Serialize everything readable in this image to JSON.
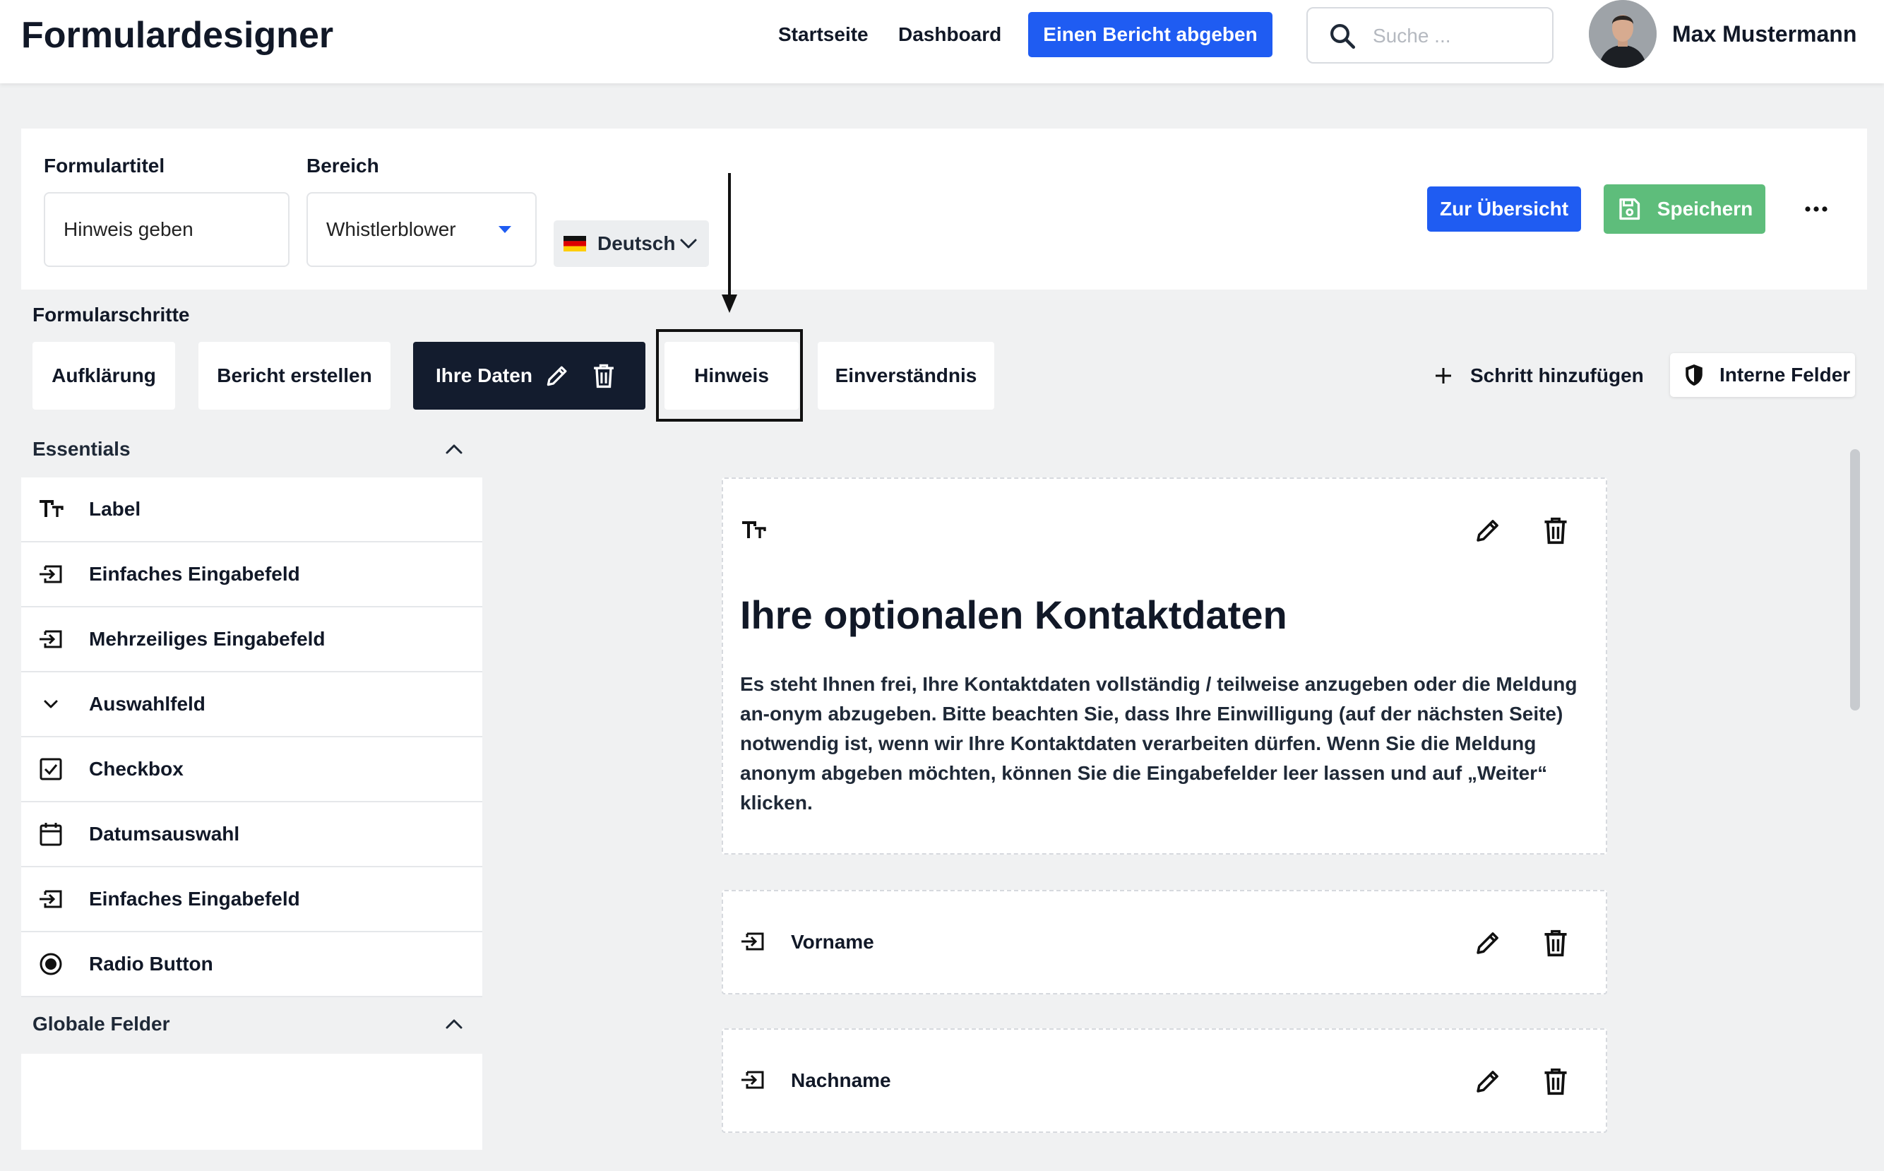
{
  "header": {
    "app_title": "Formulardesigner",
    "nav": [
      "Startseite",
      "Dashboard"
    ],
    "report_button": "Einen Bericht abgeben",
    "search_placeholder": "Suche ...",
    "user_name": "Max Mustermann"
  },
  "form": {
    "title_label": "Formulartitel",
    "title_value": "Hinweis geben",
    "area_label": "Bereich",
    "area_value": "Whistlerblower",
    "language": "Deutsch",
    "overview_button": "Zur Übersicht",
    "save_button": "Speichern"
  },
  "steps": {
    "label": "Formularschritte",
    "tabs": [
      "Aufklärung",
      "Bericht erstellen",
      "Ihre Daten",
      "Hinweis",
      "Einverständnis"
    ],
    "add_step": "Schritt hinzufügen",
    "internal_fields": "Interne Felder"
  },
  "sidebar": {
    "essentials_title": "Essentials",
    "items": [
      {
        "label": "Label",
        "icon": "text-type-icon"
      },
      {
        "label": "Einfaches Eingabefeld",
        "icon": "input-field-icon"
      },
      {
        "label": "Mehrzeiliges Eingabefeld",
        "icon": "input-field-icon"
      },
      {
        "label": "Auswahlfeld",
        "icon": "chevron-down-icon"
      },
      {
        "label": "Checkbox",
        "icon": "checkbox-icon"
      },
      {
        "label": "Datumsauswahl",
        "icon": "calendar-icon"
      },
      {
        "label": "Einfaches Eingabefeld",
        "icon": "input-field-icon"
      },
      {
        "label": "Radio Button",
        "icon": "radio-icon"
      }
    ],
    "global_title": "Globale Felder"
  },
  "canvas": {
    "heading": "Ihre optionalen Kontaktdaten",
    "body": "Es steht Ihnen frei, Ihre Kontaktdaten vollständig / teilweise anzugeben oder die Meldung an-onym abzugeben. Bitte beachten Sie, dass Ihre Einwilligung (auf der nächsten Seite) notwendig ist, wenn wir Ihre Kontaktdaten verarbeiten dürfen. Wenn Sie die Meldung anonym abgeben möchten, können Sie die Eingabefelder leer lassen und auf „Weiter“ klicken.",
    "fields": [
      "Vorname",
      "Nachname"
    ]
  },
  "colors": {
    "primary": "#1f5cf2",
    "success": "#5ebd7b",
    "dark": "#131c2e"
  }
}
